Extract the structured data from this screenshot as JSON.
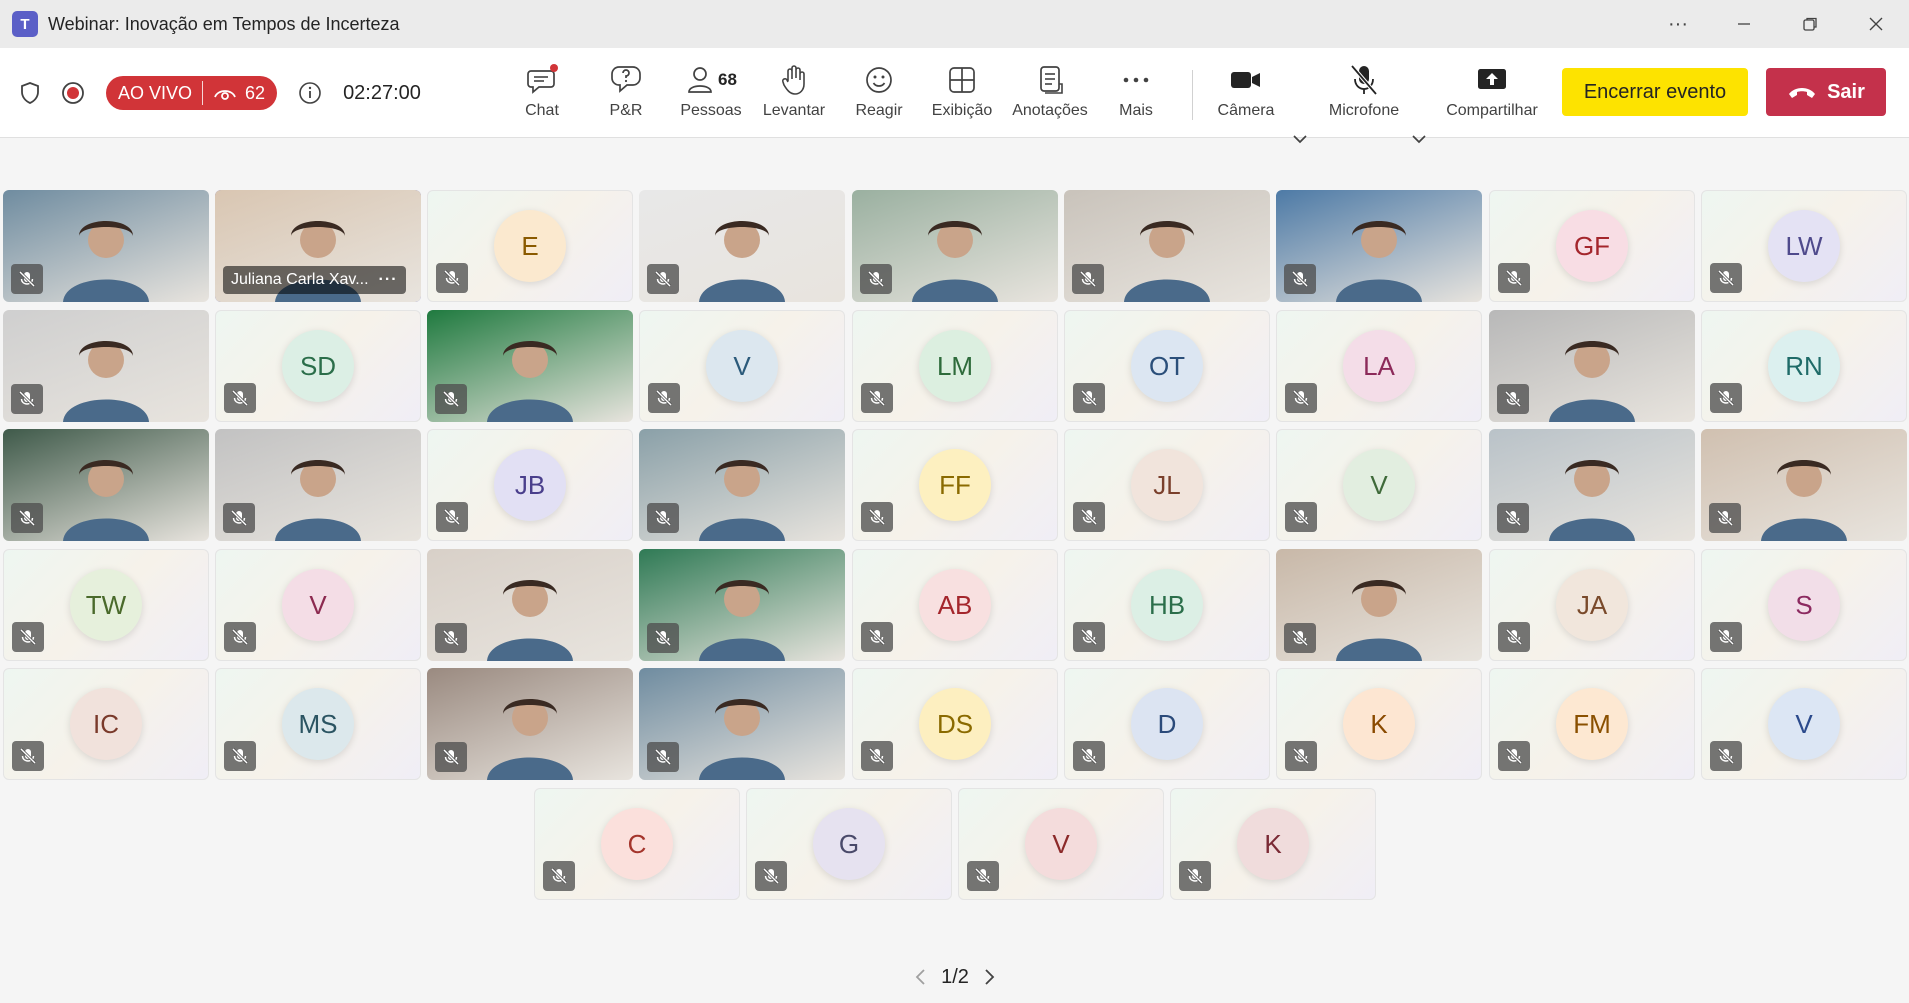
{
  "window": {
    "title": "Webinar: Inovação em Tempos de Incerteza",
    "logo_letter": "T",
    "more_label": "···"
  },
  "status": {
    "live_label": "AO VIVO",
    "viewers": "62",
    "timer": "02:27:00"
  },
  "toolbar": {
    "chat": "Chat",
    "qa": "P&R",
    "people": "Pessoas",
    "people_count": "68",
    "raise": "Levantar",
    "react": "Reagir",
    "view": "Exibição",
    "notes": "Anotações",
    "more": "Mais",
    "camera": "Câmera",
    "mic": "Microfone",
    "share": "Compartilhar",
    "end_event": "Encerrar evento",
    "leave": "Sair"
  },
  "participants": [
    {
      "type": "video",
      "label": ""
    },
    {
      "type": "video",
      "label": "Juliana Carla Xav...",
      "selected": true
    },
    {
      "type": "avatar",
      "label": "E",
      "bg": "#fbe9cf",
      "fg": "#8a5a00"
    },
    {
      "type": "video",
      "label": ""
    },
    {
      "type": "video",
      "label": ""
    },
    {
      "type": "video",
      "label": ""
    },
    {
      "type": "video",
      "label": ""
    },
    {
      "type": "avatar",
      "label": "GF",
      "bg": "#f8dde4",
      "fg": "#a4262c"
    },
    {
      "type": "avatar",
      "label": "LW",
      "bg": "#e4e2f4",
      "fg": "#4f4a8c"
    },
    {
      "type": "video",
      "label": ""
    },
    {
      "type": "avatar",
      "label": "SD",
      "bg": "#dcefe5",
      "fg": "#2b6e4a"
    },
    {
      "type": "video",
      "label": ""
    },
    {
      "type": "avatar",
      "label": "V",
      "bg": "#dce7ef",
      "fg": "#2b5a7a"
    },
    {
      "type": "avatar",
      "label": "LM",
      "bg": "#dcefe0",
      "fg": "#2e6b3b"
    },
    {
      "type": "avatar",
      "label": "OT",
      "bg": "#dce6f2",
      "fg": "#2b4f7a"
    },
    {
      "type": "avatar",
      "label": "LA",
      "bg": "#f4dde8",
      "fg": "#8c2a5a"
    },
    {
      "type": "video",
      "label": ""
    },
    {
      "type": "avatar",
      "label": "RN",
      "bg": "#dcf0ef",
      "fg": "#1f6b68"
    },
    {
      "type": "video",
      "label": ""
    },
    {
      "type": "video",
      "label": ""
    },
    {
      "type": "avatar",
      "label": "JB",
      "bg": "#e2e0f4",
      "fg": "#4a3f8c"
    },
    {
      "type": "video",
      "label": ""
    },
    {
      "type": "avatar",
      "label": "FF",
      "bg": "#fdf0c0",
      "fg": "#8a6a00"
    },
    {
      "type": "avatar",
      "label": "JL",
      "bg": "#f1e4dc",
      "fg": "#7a3f2b"
    },
    {
      "type": "avatar",
      "label": "V",
      "bg": "#e2eee0",
      "fg": "#3f6a3a"
    },
    {
      "type": "video",
      "label": ""
    },
    {
      "type": "video",
      "label": ""
    },
    {
      "type": "avatar",
      "label": "TW",
      "bg": "#e6f0dc",
      "fg": "#4a6a2b"
    },
    {
      "type": "avatar",
      "label": "V",
      "bg": "#f4dde6",
      "fg": "#8c2a50"
    },
    {
      "type": "video",
      "label": ""
    },
    {
      "type": "video",
      "label": ""
    },
    {
      "type": "avatar",
      "label": "AB",
      "bg": "#f8e0e0",
      "fg": "#a4262c"
    },
    {
      "type": "avatar",
      "label": "HB",
      "bg": "#dcefe5",
      "fg": "#2b6e4a"
    },
    {
      "type": "video",
      "label": ""
    },
    {
      "type": "avatar",
      "label": "JA",
      "bg": "#f1e6dc",
      "fg": "#7a4a2b"
    },
    {
      "type": "avatar",
      "label": "S",
      "bg": "#f2dee8",
      "fg": "#8c2a60"
    },
    {
      "type": "avatar",
      "label": "IC",
      "bg": "#f1e2dc",
      "fg": "#7a3a2b"
    },
    {
      "type": "avatar",
      "label": "MS",
      "bg": "#dce8ec",
      "fg": "#2b5462"
    },
    {
      "type": "video",
      "label": ""
    },
    {
      "type": "video",
      "label": ""
    },
    {
      "type": "avatar",
      "label": "DS",
      "bg": "#fdefc0",
      "fg": "#8a6a00"
    },
    {
      "type": "avatar",
      "label": "D",
      "bg": "#dce4f2",
      "fg": "#2b4a7a"
    },
    {
      "type": "avatar",
      "label": "K",
      "bg": "#fde6d2",
      "fg": "#8a4a00"
    },
    {
      "type": "avatar",
      "label": "FM",
      "bg": "#fde8d2",
      "fg": "#8a5000"
    },
    {
      "type": "avatar",
      "label": "V",
      "bg": "#dce6f4",
      "fg": "#2b4a8c"
    },
    {
      "type": "avatar",
      "label": "C",
      "bg": "#fbe0dc",
      "fg": "#a4352c"
    },
    {
      "type": "avatar",
      "label": "G",
      "bg": "#e6e2f0",
      "fg": "#4a4a6a"
    },
    {
      "type": "avatar",
      "label": "V",
      "bg": "#f4dcdc",
      "fg": "#8c2a2a"
    },
    {
      "type": "avatar",
      "label": "K",
      "bg": "#f0dcdc",
      "fg": "#7a2a35"
    }
  ],
  "videos": [
    "#6f8ca0",
    "#d9c6b2",
    "#e8e8e8",
    "#9ab0a0",
    "#c9c3bb",
    "#4d7aa6",
    "#cfcfcf",
    "#1f7a3f",
    "#b8b8b8",
    "#3f5a4a",
    "#c2c2c2",
    "#8aa0a8",
    "#b9c2c8",
    "#d0c0b0",
    "#d8d0c8",
    "#2f7a55",
    "#c8b8a8",
    "#9a8a80"
  ],
  "pagination": {
    "label": "1/2"
  }
}
